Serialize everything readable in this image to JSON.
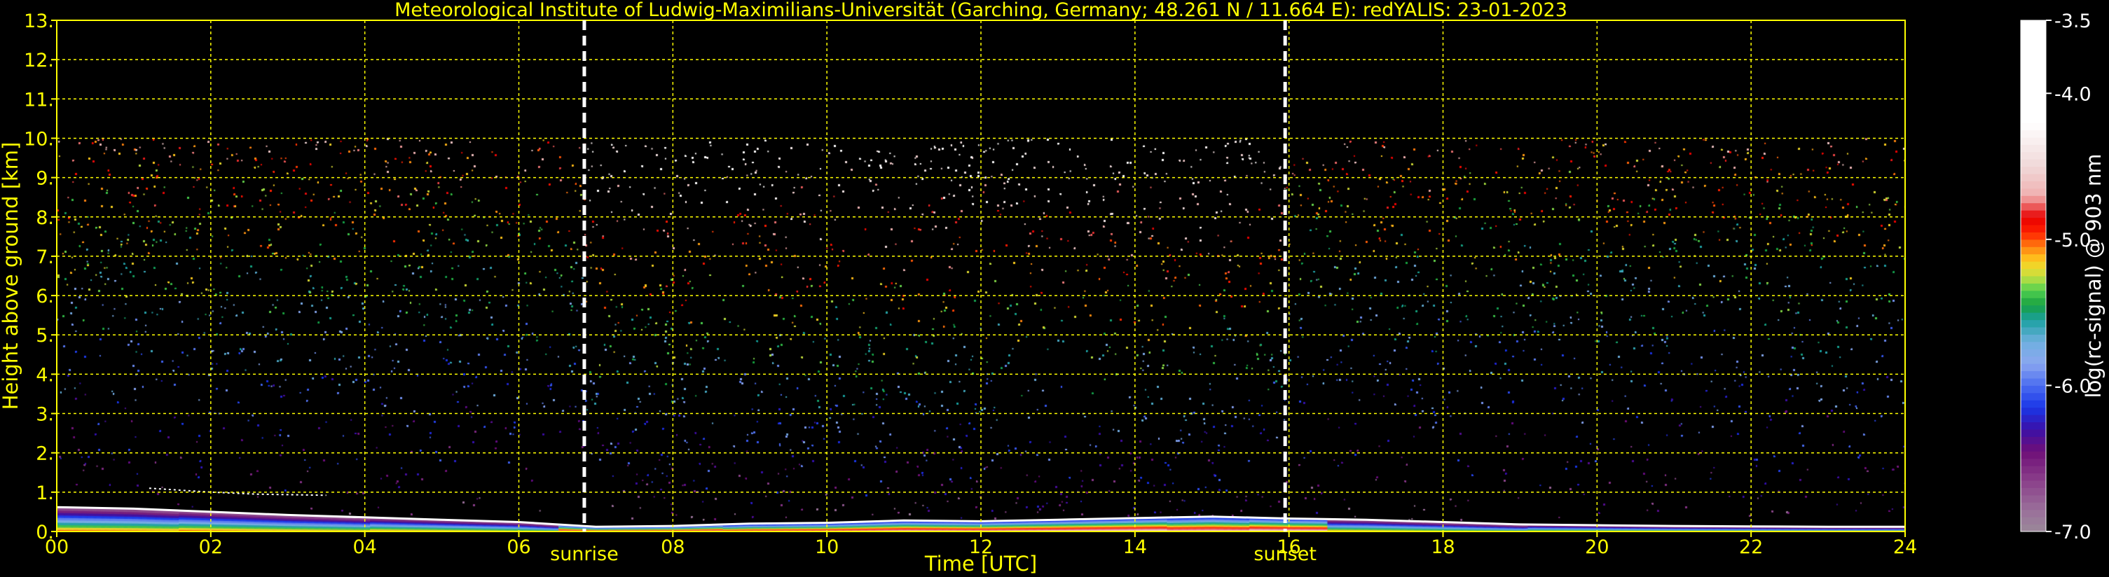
{
  "chart_data": {
    "type": "heatmap",
    "title": "Meteorological Institute of Ludwig-Maximilians-Universität (Garching, Germany; 48.261 N / 11.664 E):    redYALIS: 23-01-2023",
    "xlabel": "Time [UTC]",
    "ylabel": "Height above ground [km]",
    "xlim": [
      0,
      24
    ],
    "ylim": [
      0,
      13
    ],
    "x_ticks": [
      "00",
      "02",
      "04",
      "06",
      "08",
      "10",
      "12",
      "14",
      "16",
      "18",
      "20",
      "22",
      "24"
    ],
    "y_ticks": [
      "0.",
      "1.",
      "2.",
      "3.",
      "4.",
      "5.",
      "6.",
      "7.",
      "8.",
      "9.",
      "10.",
      "11.",
      "12.",
      "13."
    ],
    "grid": true,
    "grid_color": "#ffff00",
    "markers": [
      {
        "label": "sunrise",
        "x": 6.85,
        "color": "#ffffff",
        "style": "dashed"
      },
      {
        "label": "sunset",
        "x": 15.95,
        "color": "#ffffff",
        "style": "dashed"
      }
    ],
    "signal_top_km": 10,
    "colorbar": {
      "label": "log(rc-signal) @ 903 nm",
      "range": [
        -7.0,
        -3.5
      ],
      "ticks": [
        "-3.5",
        "-4.0",
        "-5.0",
        "-6.0",
        "-7.0"
      ],
      "tick_values": [
        -3.5,
        -4.0,
        -5.0,
        -6.0,
        -7.0
      ],
      "colors": [
        {
          "v": -7.0,
          "c": "#9a8899"
        },
        {
          "v": -6.85,
          "c": "#9a6f9a"
        },
        {
          "v": -6.65,
          "c": "#8a3f8a"
        },
        {
          "v": -6.45,
          "c": "#6f0f78"
        },
        {
          "v": -6.3,
          "c": "#3a10a8"
        },
        {
          "v": -6.15,
          "c": "#1a36e8"
        },
        {
          "v": -6.0,
          "c": "#4a6cf0"
        },
        {
          "v": -5.85,
          "c": "#8aa6f0"
        },
        {
          "v": -5.7,
          "c": "#70b0e0"
        },
        {
          "v": -5.55,
          "c": "#1aa0a0"
        },
        {
          "v": -5.45,
          "c": "#18a040"
        },
        {
          "v": -5.35,
          "c": "#50d050"
        },
        {
          "v": -5.25,
          "c": "#c8e040"
        },
        {
          "v": -5.15,
          "c": "#ffd020"
        },
        {
          "v": -5.05,
          "c": "#ff8010"
        },
        {
          "v": -4.95,
          "c": "#ff2000"
        },
        {
          "v": -4.85,
          "c": "#e80000"
        },
        {
          "v": -4.7,
          "c": "#f0b0b0"
        },
        {
          "v": -4.5,
          "c": "#f0d8d8"
        },
        {
          "v": -4.2,
          "c": "#ffffff"
        },
        {
          "v": -3.5,
          "c": "#ffffff"
        }
      ]
    },
    "boundary_layer_height_km": [
      {
        "t": 0.0,
        "h": 0.62
      },
      {
        "t": 1.0,
        "h": 0.58
      },
      {
        "t": 2.0,
        "h": 0.5
      },
      {
        "t": 3.0,
        "h": 0.42
      },
      {
        "t": 4.0,
        "h": 0.36
      },
      {
        "t": 5.0,
        "h": 0.3
      },
      {
        "t": 6.0,
        "h": 0.24
      },
      {
        "t": 7.0,
        "h": 0.12
      },
      {
        "t": 8.0,
        "h": 0.14
      },
      {
        "t": 9.0,
        "h": 0.2
      },
      {
        "t": 10.0,
        "h": 0.22
      },
      {
        "t": 11.0,
        "h": 0.28
      },
      {
        "t": 12.0,
        "h": 0.26
      },
      {
        "t": 13.0,
        "h": 0.3
      },
      {
        "t": 14.0,
        "h": 0.34
      },
      {
        "t": 15.0,
        "h": 0.38
      },
      {
        "t": 16.0,
        "h": 0.33
      },
      {
        "t": 17.0,
        "h": 0.3
      },
      {
        "t": 18.0,
        "h": 0.24
      },
      {
        "t": 19.0,
        "h": 0.18
      },
      {
        "t": 20.0,
        "h": 0.16
      },
      {
        "t": 21.0,
        "h": 0.14
      },
      {
        "t": 22.0,
        "h": 0.13
      },
      {
        "t": 23.0,
        "h": 0.12
      },
      {
        "t": 24.0,
        "h": 0.12
      }
    ],
    "residual_layer_top_km": [
      {
        "t": 1.2,
        "h": 1.1
      },
      {
        "t": 2.0,
        "h": 1.0
      },
      {
        "t": 2.6,
        "h": 0.95
      },
      {
        "t": 3.5,
        "h": 0.92
      }
    ]
  }
}
